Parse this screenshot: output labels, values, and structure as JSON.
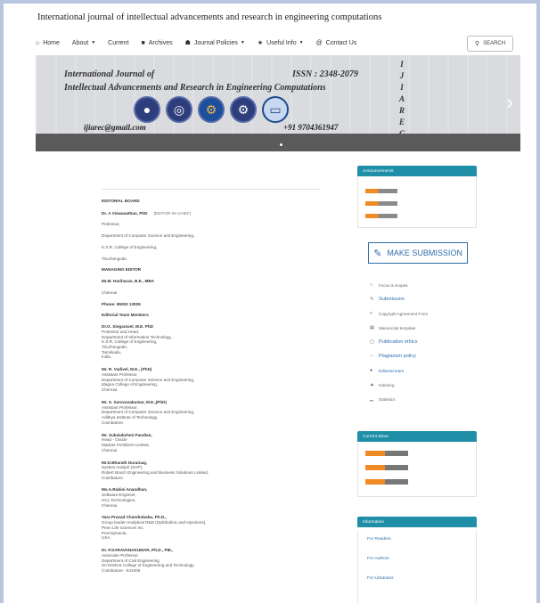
{
  "header": {
    "site_title": "International journal of intellectual advancements and research in engineering computations"
  },
  "nav": {
    "items": [
      {
        "label": "Home",
        "icon": "home-icon",
        "glyph": "⌂",
        "caret": false
      },
      {
        "label": "About",
        "icon": "",
        "glyph": "",
        "caret": true
      },
      {
        "label": "Current",
        "icon": "",
        "glyph": "",
        "caret": false
      },
      {
        "label": "Archives",
        "icon": "archive-icon",
        "glyph": "■",
        "caret": false
      },
      {
        "label": "Journal Policies",
        "icon": "bank-icon",
        "glyph": "☗",
        "caret": true
      },
      {
        "label": "Useful Info",
        "icon": "link-icon",
        "glyph": "★",
        "caret": true
      },
      {
        "label": "Contact Us",
        "icon": "at-icon",
        "glyph": "@",
        "caret": false
      }
    ],
    "search_label": "SEARCH"
  },
  "banner": {
    "title_line1": "International Journal of",
    "title_line2": "Intellectual Advancements and Research in Engineering Computations",
    "issn": "ISSN : 2348-2079",
    "email": "ijiarec@gmail.com",
    "phone": "+91 9704361947",
    "side_letters": [
      "I",
      "J",
      "I",
      "A",
      "R",
      "E",
      "C"
    ]
  },
  "content": {
    "section_title": "EDITORIAL BOARD",
    "chief": {
      "name": "Dr. A Viswanathan, PhD",
      "tag": "[EDITOR-IN-CHIEF]"
    },
    "chief_lines": [
      "Professor,",
      "Department of Computer Science and Engineering,",
      "K.S.R. College of Engineering,",
      "Tiruchengode."
    ],
    "managing_title": "MANAGING EDITOR",
    "managing_name": "Mr.M. Hariharan, B.E., MBA",
    "managing_city": "Chennai",
    "phone": "Phone: 95003 13009",
    "team_title": "Editorial Team Members",
    "members": [
      {
        "name": "Dr.G. Singaravel, M.E. PhD",
        "lines": [
          "Professor and Head,",
          "Department of Information Technology,",
          "K.S.R. College of Engineering,",
          "Tiruchengode,",
          "Tamilnadu,",
          "India."
        ]
      },
      {
        "name": "Mr. R. Vadivel, M.E., (PhD)",
        "lines": [
          "Assistant Professor,",
          "Department of Computer Science and Engineering,",
          "Magna College of Engineering,",
          "Chennai."
        ]
      },
      {
        "name": "Mr. S. Saravanakumar, M.E.,(PhD)",
        "lines": [
          "Assistant Professor,",
          "Department of Computer Science and Engineering,",
          "Adithya Institute of Technology,",
          "Coimbatore."
        ]
      },
      {
        "name": "Mr. Subalakshmi Pandian,",
        "lines": [
          "Head - Oracle",
          "Madras Fertilizers Limited,",
          "Chennai."
        ]
      },
      {
        "name": "Mr.D.Bharath Durairaaj,",
        "lines": [
          "System Analyst (SAP),",
          "Robert Bosch Engineering and Business Solutions Limited,",
          "Coimbatore."
        ]
      },
      {
        "name": "Ms.A.Rubini Anandhan,",
        "lines": [
          "Software Engineer,",
          "HCL Technologies,",
          "Chennai."
        ]
      },
      {
        "name": "Vara Prasad Chandrababu, Ph.D.,",
        "lines": [
          "Group leader-Analytical R&D (Ophthalmic and Injections),",
          "Penn Life Sciences Inc.",
          "Pennsylvania,",
          "USA."
        ]
      }
    ],
    "last_member": {
      "name": "Dr. P.SARAVANAKUMAR, Ph.D., PIE.,",
      "lines": [
        "Associate Professor",
        "Department of Civil Engineering",
        "Sri Krishna College of Engineering and Technology",
        "Coimbatore - 641008"
      ]
    }
  },
  "sidebar": {
    "announcements_title": "Announcements",
    "make_submission_label": "MAKE SUBMISSION",
    "menu": [
      {
        "label": "Focus & scopes",
        "icon": "circle-icon",
        "glyph": "○",
        "style": ""
      },
      {
        "label": "Submission",
        "icon": "edit-icon",
        "glyph": "✎",
        "style": "big"
      },
      {
        "label": "Copyright Agreement Form",
        "icon": "document-icon",
        "glyph": "□",
        "style": ""
      },
      {
        "label": "Manuscript template",
        "icon": "template-icon",
        "glyph": "▤",
        "style": ""
      },
      {
        "label": "Publication ethics",
        "icon": "ethics-icon",
        "glyph": "▢",
        "style": "big"
      },
      {
        "label": "Plagiarism policy",
        "icon": "policy-icon",
        "glyph": "◔",
        "style": "big"
      },
      {
        "label": "Editorial team",
        "icon": "team-icon",
        "glyph": "●",
        "style": "blue"
      },
      {
        "label": "Indexing",
        "icon": "indexing-icon",
        "glyph": "▲",
        "style": ""
      },
      {
        "label": "Statistics",
        "icon": "chart-icon",
        "glyph": "▁",
        "style": ""
      }
    ],
    "current_issue_title": "Current Issue",
    "information_title": "Information",
    "info_links": [
      "For Readers",
      "For Authors",
      "For Librarians"
    ]
  }
}
